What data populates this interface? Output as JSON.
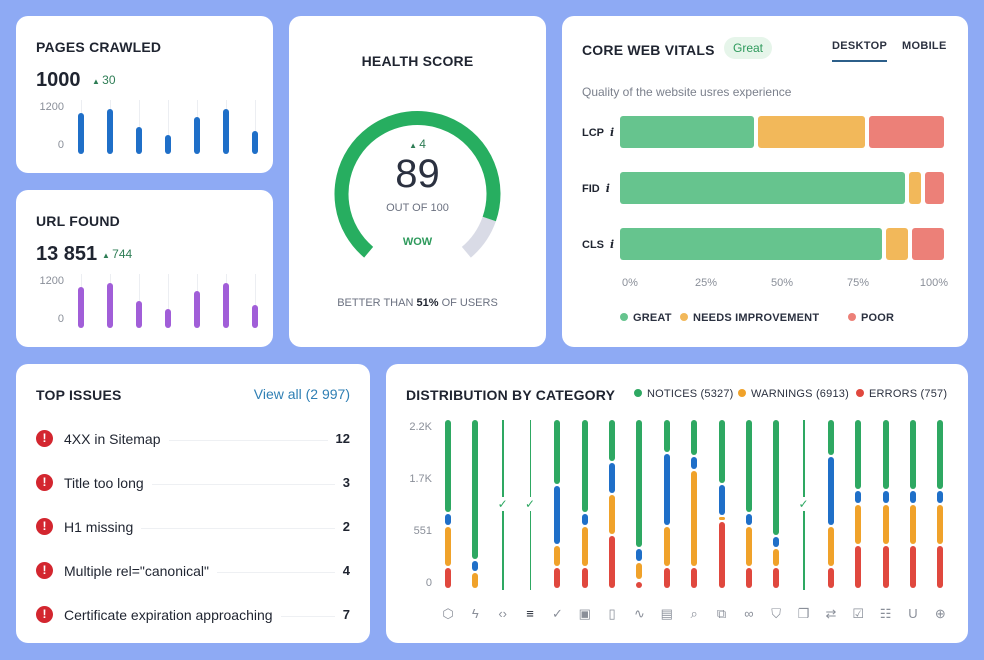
{
  "pages_crawled": {
    "title": "PAGES CRAWLED",
    "value": "1000",
    "delta": "30",
    "axis": [
      "1200",
      "0"
    ],
    "values": [
      1070,
      1170,
      700,
      490,
      960,
      1170,
      600
    ],
    "color": "#1f6fc8"
  },
  "url_found": {
    "title": "URL FOUND",
    "value": "13 851",
    "delta": "744",
    "axis": [
      "1200",
      "0"
    ],
    "values": [
      1070,
      1170,
      700,
      490,
      960,
      1170,
      600
    ],
    "color": "#a15ed8"
  },
  "health": {
    "title": "HEALTH SCORE",
    "delta": "4",
    "score": "89",
    "score_value": 89,
    "out_of": "OUT OF 100",
    "verdict": "WOW",
    "footer_pre": "BETTER THAN",
    "footer_pct": "51%",
    "footer_post": "OF USERS",
    "color": "#27ae60",
    "track_color": "#d9dbe6"
  },
  "cwv": {
    "title": "CORE WEB VITALS",
    "badge": "Great",
    "tabs": [
      {
        "label": "DESKTOP",
        "active": true
      },
      {
        "label": "MOBILE",
        "active": false
      }
    ],
    "subtitle": "Quality of the website usres experience",
    "metrics": [
      {
        "label": "LCP",
        "great": 42,
        "needs": 34,
        "poor": 24
      },
      {
        "label": "FID",
        "great": 88,
        "needs": 5,
        "poor": 7
      },
      {
        "label": "CLS",
        "great": 81,
        "needs": 8,
        "poor": 11
      }
    ],
    "info_icon": "i",
    "axis": [
      "0%",
      "25%",
      "50%",
      "75%",
      "100%"
    ],
    "legend": [
      {
        "label": "GREAT",
        "color": "#66c48e"
      },
      {
        "label": "NEEDS IMPROVEMENT",
        "color": "#f2b85a"
      },
      {
        "label": "POOR",
        "color": "#ec8078"
      }
    ]
  },
  "top_issues": {
    "title": "TOP ISSUES",
    "view_all": "View all (2 997)",
    "items": [
      {
        "name": "4XX in Sitemap",
        "count": "12"
      },
      {
        "name": "Title too long",
        "count": "3"
      },
      {
        "name": "H1 missing",
        "count": "2"
      },
      {
        "name": "Multiple rel=\"canonical\"",
        "count": "4"
      },
      {
        "name": "Certificate expiration approaching",
        "count": "7"
      }
    ]
  },
  "distribution": {
    "title": "DISTRIBUTION BY CATEGORY",
    "legend": [
      {
        "label": "NOTICES (5327)",
        "color": "#2ea862"
      },
      {
        "label": "WARNINGS (6913)",
        "color": "#f0a22a"
      },
      {
        "label": "ERRORS (757)",
        "color": "#e0483e"
      }
    ],
    "colors": {
      "errors": "#e0483e",
      "warnings": "#f0a22a",
      "other": "#1f6fc8",
      "notices": "#2ea862"
    }
  },
  "chart_data": {
    "type": "bar",
    "stacked": true,
    "ytick_labels": [
      "2.2K",
      "1.7K",
      "551",
      "0"
    ],
    "unit": "percent of column height",
    "segment_order": [
      "errors",
      "warnings",
      "other",
      "notices"
    ],
    "categories": [
      "js",
      "speed",
      "code",
      "redirects",
      "ok",
      "images",
      "mobile",
      "performance",
      "content",
      "search",
      "external-links",
      "links",
      "security",
      "duplicates",
      "redirect-chains",
      "indexing",
      "settings",
      "markup",
      "international"
    ],
    "icons": [
      "⬡",
      "ϟ",
      "‹›",
      "≡",
      "✓",
      "▣",
      "▯",
      "∿",
      "▤",
      "⌕",
      "⧉",
      "∞",
      "⛉",
      "❐",
      "⇄",
      "☑",
      "☷",
      "U",
      "⊕"
    ],
    "columns": [
      [
        13,
        24,
        8,
        55
      ],
      [
        0,
        10,
        7,
        83
      ],
      null,
      null,
      [
        13,
        13,
        35,
        39
      ],
      [
        13,
        24,
        8,
        55
      ],
      [
        32,
        24,
        19,
        25
      ],
      [
        5,
        11,
        8,
        76
      ],
      [
        13,
        24,
        43,
        20
      ],
      [
        13,
        57,
        8,
        22
      ],
      [
        40,
        3,
        19,
        38
      ],
      [
        13,
        24,
        8,
        55
      ],
      [
        13,
        11,
        7,
        69
      ],
      null,
      [
        13,
        24,
        41,
        22
      ],
      [
        26,
        24,
        8,
        42
      ],
      [
        26,
        24,
        8,
        42
      ],
      [
        26,
        24,
        8,
        42
      ],
      [
        26,
        24,
        8,
        42
      ]
    ]
  }
}
